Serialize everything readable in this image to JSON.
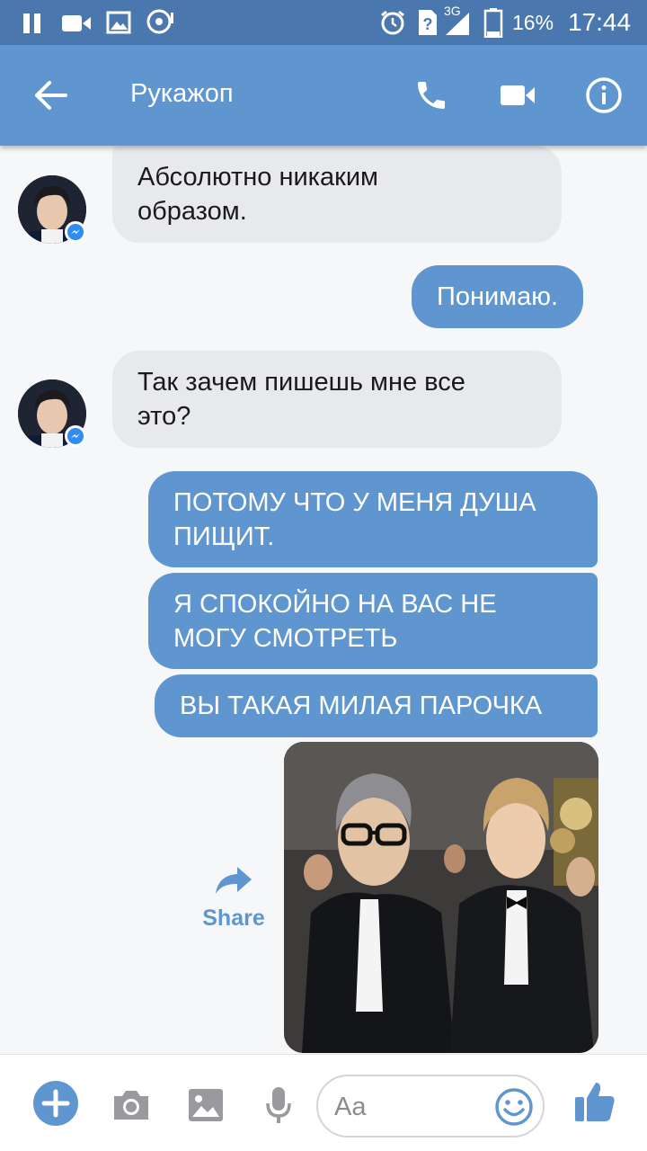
{
  "status_bar": {
    "network": "3G",
    "battery": "16%",
    "time": "17:44"
  },
  "header": {
    "title": "Рукажоп"
  },
  "messages": [
    {
      "side": "in",
      "lines": [
        "Абсолютно никаким",
        "образом."
      ]
    },
    {
      "side": "out",
      "lines": [
        "Понимаю."
      ]
    },
    {
      "side": "in",
      "lines": [
        "Так зачем пишешь мне все",
        "это?"
      ]
    },
    {
      "side": "out",
      "lines": [
        "ПОТОМУ ЧТО У МЕНЯ ДУША",
        "ПИЩИТ."
      ]
    },
    {
      "side": "out",
      "lines": [
        "Я СПОКОЙНО НА ВАС НЕ",
        "МОГУ СМОТРЕТЬ"
      ]
    },
    {
      "side": "out",
      "lines": [
        "ВЫ ТАКАЯ МИЛАЯ ПАРОЧКА"
      ]
    }
  ],
  "share": {
    "label": "Share"
  },
  "composer": {
    "placeholder": "Aa"
  },
  "colors": {
    "accent": "#5f96d0",
    "status_bar": "#4a78ae",
    "incoming_bubble": "#e8e9ed"
  },
  "icons": [
    "pause-icon",
    "video-call-notification-icon",
    "gallery-notification-icon",
    "vk-notification-icon",
    "alarm-icon",
    "sim-icon",
    "signal-icon",
    "battery-icon",
    "back-arrow-icon",
    "phone-icon",
    "video-camera-icon",
    "info-icon",
    "messenger-badge-icon",
    "share-arrow-icon",
    "plus-icon",
    "camera-icon",
    "image-icon",
    "microphone-icon",
    "emoji-icon",
    "thumbs-up-icon"
  ]
}
